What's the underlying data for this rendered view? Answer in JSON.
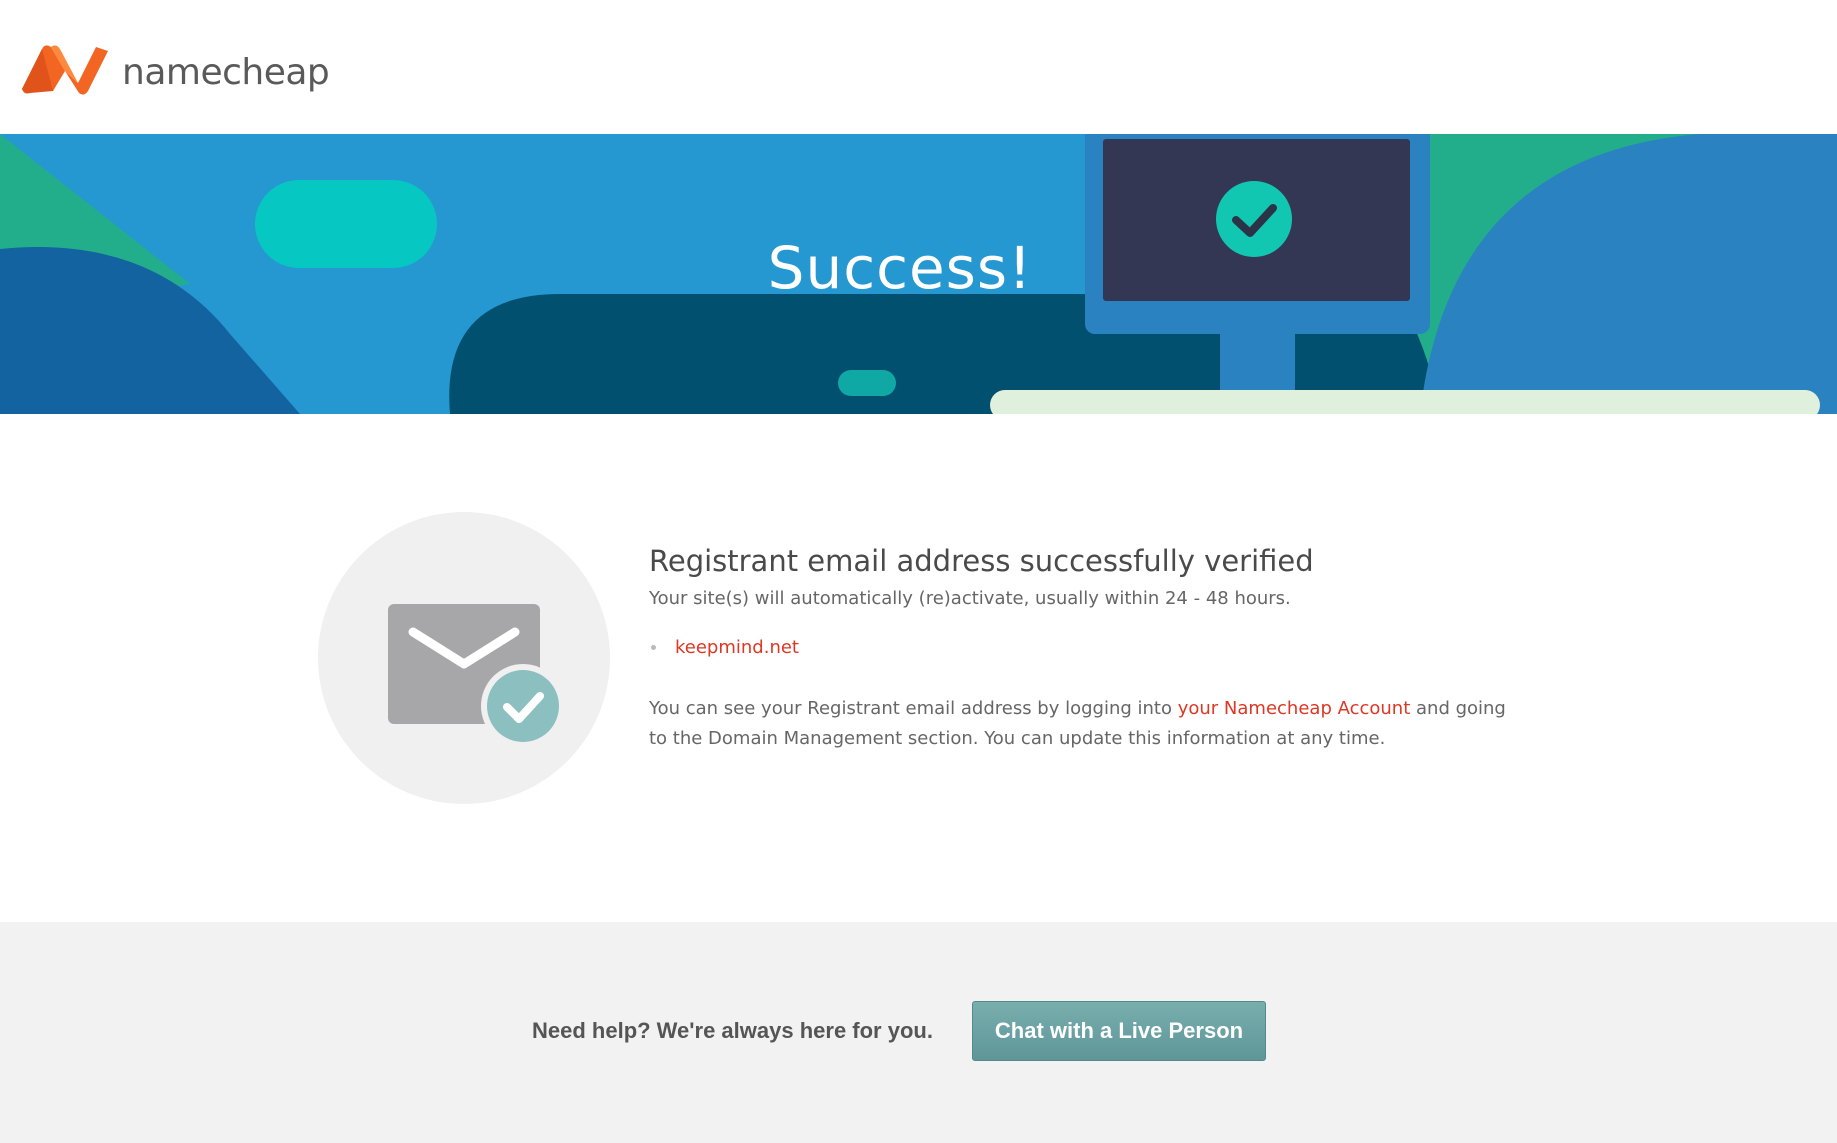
{
  "header": {
    "brand_name": "namecheap"
  },
  "hero": {
    "title": "Success!"
  },
  "main": {
    "heading": "Registrant email address successfully verified",
    "subtext": "Your site(s) will automatically (re)activate, usually within 24 - 48 hours.",
    "domains": [
      "keepmind.net"
    ],
    "info_before_link": "You can see your Registrant email address by logging into ",
    "info_link": "your Namecheap Account",
    "info_after_link": " and going to the Domain Management section. You can update this information at any time."
  },
  "help": {
    "text": "Need help? We're always here for you.",
    "button_label": "Chat with a Live Person"
  },
  "colors": {
    "brand_orange": "#f26522",
    "link_red": "#de3723",
    "hero_blue": "#2598d1",
    "button_teal": "#6aa3a4"
  },
  "icons": {
    "logo": "namecheap-logo-icon",
    "email_verified": "envelope-check-icon",
    "monitor_check": "monitor-check-icon"
  }
}
